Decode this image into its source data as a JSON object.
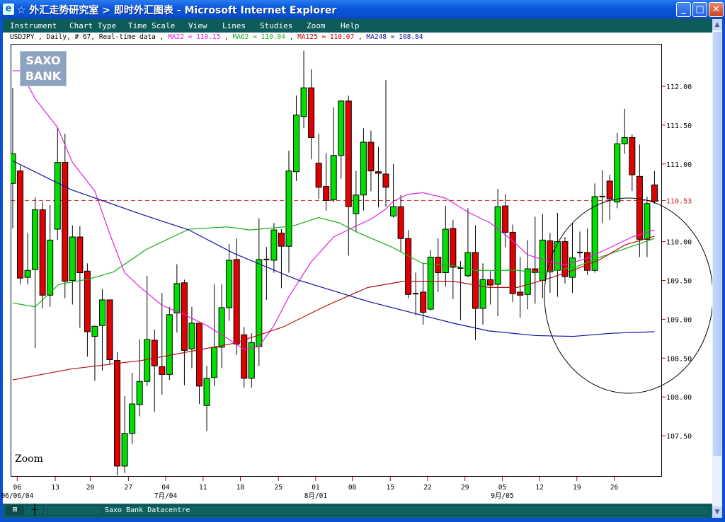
{
  "window": {
    "title": "☆ 外汇走势研究室 > 即时外汇图表 - Microsoft Internet Explorer",
    "app_icon": "ie-icon",
    "buttons": {
      "minimize": "_",
      "maximize": "□",
      "close": "✕"
    }
  },
  "menu": [
    "Instrument",
    "Chart Type",
    "Time Scale",
    "View",
    "Lines",
    "Studies",
    "Zoom",
    "Help"
  ],
  "info": {
    "instrument": "USDJPY , Daily, # 67, Real-time data",
    "sep": " , ",
    "ma22": "MA22 = 110.15",
    "ma62": "MA62 = 110.04",
    "ma125": "MA125 = 110.07",
    "ma248": "MA248 = 108.84"
  },
  "logo": {
    "line1": "SAXO",
    "line2": "BANK"
  },
  "zoom_label": "Zoom",
  "status": {
    "text": "Saxo Bank Datacentre"
  },
  "colors": {
    "up": "#00e000",
    "down": "#e00000",
    "ma22": "#e020e0",
    "ma62": "#18b018",
    "ma125": "#b01010",
    "ma248": "#1010a0",
    "menu_bg": "#0e5b5b"
  },
  "chart_data": {
    "type": "candlestick",
    "title": "USDJPY Daily",
    "ylim": [
      106.9,
      112.55
    ],
    "y_ticks": [
      "112.00",
      "111.50",
      "111.00",
      "110.00",
      "109.50",
      "109.00",
      "108.50",
      "108.00",
      "107.50"
    ],
    "current_price": "110.53",
    "x_ticks": [
      {
        "label": "06",
        "index": 0.6,
        "sub": "06/06/04"
      },
      {
        "label": "13",
        "index": 5.7
      },
      {
        "label": "20",
        "index": 10.4
      },
      {
        "label": "27",
        "index": 15.5
      },
      {
        "label": "04",
        "index": 20.5,
        "sub": "7月/04"
      },
      {
        "label": "11",
        "index": 25.5
      },
      {
        "label": "18",
        "index": 30.5
      },
      {
        "label": "25",
        "index": 35.6
      },
      {
        "label": "01",
        "index": 40.6,
        "sub": "8月/01"
      },
      {
        "label": "08",
        "index": 45.5
      },
      {
        "label": "15",
        "index": 50.6
      },
      {
        "label": "22",
        "index": 55.6
      },
      {
        "label": "29",
        "index": 60.6
      },
      {
        "label": "05",
        "index": 65.6,
        "sub": "9月/05"
      },
      {
        "label": "12",
        "index": 70.6
      },
      {
        "label": "19",
        "index": 75.6
      },
      {
        "label": "26",
        "index": 80.6
      }
    ],
    "ohlc": [
      [
        110.75,
        111.98,
        110.17,
        111.13
      ],
      [
        110.91,
        110.98,
        109.45,
        109.53
      ],
      [
        109.54,
        110.11,
        109.45,
        109.63
      ],
      [
        109.64,
        110.57,
        108.63,
        110.41
      ],
      [
        110.41,
        110.51,
        109.14,
        109.31
      ],
      [
        109.31,
        110.47,
        109.16,
        110.02
      ],
      [
        110.16,
        111.47,
        110.02,
        111.02
      ],
      [
        111.02,
        111.39,
        109.27,
        109.49
      ],
      [
        109.5,
        110.21,
        109.19,
        110.06
      ],
      [
        110.06,
        110.2,
        108.89,
        109.6
      ],
      [
        109.62,
        109.72,
        108.52,
        108.84
      ],
      [
        108.78,
        108.92,
        108.21,
        108.91
      ],
      [
        108.92,
        109.39,
        108.34,
        109.25
      ],
      [
        109.25,
        109.25,
        108.42,
        108.48
      ],
      [
        108.47,
        108.58,
        106.99,
        107.11
      ],
      [
        107.11,
        108.01,
        107.02,
        107.53
      ],
      [
        107.53,
        108.31,
        107.39,
        107.91
      ],
      [
        107.9,
        108.74,
        107.75,
        108.2
      ],
      [
        108.2,
        109.56,
        108.14,
        108.74
      ],
      [
        108.73,
        108.87,
        107.81,
        108.4
      ],
      [
        108.39,
        109.34,
        108.03,
        108.29
      ],
      [
        108.29,
        109.16,
        108.22,
        109.06
      ],
      [
        109.08,
        109.71,
        108.83,
        109.46
      ],
      [
        109.47,
        109.51,
        108.15,
        108.6
      ],
      [
        108.62,
        109.16,
        108.37,
        108.95
      ],
      [
        108.95,
        108.95,
        107.91,
        108.14
      ],
      [
        107.89,
        108.4,
        107.56,
        108.24
      ],
      [
        108.25,
        109.45,
        108.14,
        108.64
      ],
      [
        108.64,
        109.45,
        108.37,
        109.15
      ],
      [
        109.15,
        109.97,
        108.98,
        109.76
      ],
      [
        109.77,
        110.04,
        108.54,
        108.68
      ],
      [
        108.8,
        108.9,
        108.12,
        108.24
      ],
      [
        108.24,
        108.82,
        108.12,
        108.7
      ],
      [
        108.65,
        110.3,
        108.4,
        109.77
      ],
      [
        109.77,
        109.93,
        109.25,
        109.77
      ],
      [
        109.76,
        110.24,
        109.6,
        110.15
      ],
      [
        110.11,
        110.16,
        109.4,
        109.94
      ],
      [
        109.94,
        111.17,
        109.6,
        110.91
      ],
      [
        110.9,
        111.88,
        110.78,
        111.63
      ],
      [
        111.61,
        112.46,
        111.46,
        111.98
      ],
      [
        111.98,
        112.22,
        111.06,
        111.34
      ],
      [
        111.01,
        111.39,
        110.55,
        110.7
      ],
      [
        110.71,
        111.14,
        110.4,
        110.53
      ],
      [
        110.54,
        111.73,
        110.51,
        111.11
      ],
      [
        111.11,
        111.82,
        110.81,
        111.81
      ],
      [
        111.81,
        111.88,
        109.82,
        110.45
      ],
      [
        110.36,
        110.91,
        110.12,
        110.6
      ],
      [
        110.6,
        111.46,
        110.4,
        111.28
      ],
      [
        111.28,
        111.43,
        110.65,
        110.91
      ],
      [
        110.9,
        111.22,
        110.44,
        110.88
      ],
      [
        110.87,
        112.08,
        110.45,
        110.7
      ],
      [
        110.33,
        111.0,
        110.31,
        110.45
      ],
      [
        110.45,
        110.6,
        109.87,
        110.04
      ],
      [
        110.04,
        110.15,
        109.27,
        109.32
      ],
      [
        109.33,
        109.6,
        109.05,
        109.33
      ],
      [
        109.35,
        109.73,
        108.93,
        109.09
      ],
      [
        109.13,
        109.89,
        109.11,
        109.8
      ],
      [
        109.8,
        110.04,
        109.35,
        109.6
      ],
      [
        109.6,
        110.46,
        109.42,
        110.16
      ],
      [
        110.17,
        110.28,
        109.26,
        109.67
      ],
      [
        109.66,
        109.75,
        108.99,
        109.66
      ],
      [
        109.56,
        110.43,
        109.54,
        109.86
      ],
      [
        109.86,
        110.21,
        108.73,
        109.14
      ],
      [
        109.14,
        109.72,
        108.93,
        109.51
      ],
      [
        109.51,
        109.62,
        109.19,
        109.44
      ],
      [
        109.45,
        110.68,
        109.04,
        110.45
      ],
      [
        110.46,
        110.61,
        109.93,
        110.12
      ],
      [
        110.12,
        110.22,
        109.22,
        109.33
      ],
      [
        109.35,
        109.8,
        109.02,
        109.31
      ],
      [
        109.32,
        110.02,
        109.13,
        109.65
      ],
      [
        109.65,
        110.32,
        109.2,
        109.6
      ],
      [
        109.5,
        110.36,
        109.27,
        110.02
      ],
      [
        110.01,
        110.11,
        109.34,
        109.61
      ],
      [
        109.63,
        110.37,
        109.29,
        110.0
      ],
      [
        110.0,
        110.06,
        109.46,
        109.55
      ],
      [
        109.54,
        110.24,
        109.34,
        109.79
      ],
      [
        109.86,
        110.13,
        109.79,
        109.86
      ],
      [
        109.86,
        110.17,
        109.57,
        109.63
      ],
      [
        109.63,
        110.75,
        109.6,
        110.58
      ],
      [
        110.58,
        110.92,
        110.24,
        110.58
      ],
      [
        110.78,
        110.86,
        110.28,
        110.55
      ],
      [
        110.51,
        111.4,
        110.43,
        111.26
      ],
      [
        111.26,
        111.71,
        111.13,
        111.34
      ],
      [
        111.34,
        111.38,
        110.65,
        110.86
      ],
      [
        110.84,
        111.25,
        109.8,
        110.03
      ],
      [
        110.03,
        110.58,
        109.8,
        110.49
      ],
      [
        110.73,
        110.91,
        110.49,
        110.52
      ]
    ],
    "series": [
      {
        "name": "MA22",
        "color": "#e020e0",
        "points": [
          [
            0,
            112.2
          ],
          [
            1,
            112.2
          ],
          [
            3,
            111.84
          ],
          [
            6,
            111.47
          ],
          [
            8,
            111.02
          ],
          [
            11,
            110.65
          ],
          [
            13,
            110.1
          ],
          [
            15,
            109.6
          ],
          [
            17,
            109.42
          ],
          [
            20,
            109.18
          ],
          [
            23,
            109.06
          ],
          [
            26,
            108.92
          ],
          [
            29,
            108.74
          ],
          [
            31,
            108.61
          ],
          [
            33,
            108.65
          ],
          [
            35,
            108.92
          ],
          [
            37,
            109.29
          ],
          [
            40,
            109.74
          ],
          [
            43,
            110.06
          ],
          [
            46,
            110.2
          ],
          [
            48,
            110.29
          ],
          [
            50,
            110.42
          ],
          [
            51,
            110.52
          ],
          [
            53,
            110.61
          ],
          [
            55,
            110.63
          ],
          [
            58,
            110.56
          ],
          [
            61,
            110.38
          ],
          [
            64,
            110.24
          ],
          [
            67,
            110.01
          ],
          [
            69,
            109.83
          ],
          [
            72,
            109.74
          ],
          [
            74,
            109.7
          ],
          [
            77,
            109.79
          ],
          [
            80,
            109.92
          ],
          [
            83,
            110.06
          ],
          [
            86,
            110.15
          ]
        ]
      },
      {
        "name": "MA62",
        "color": "#18b018",
        "points": [
          [
            0,
            109.21
          ],
          [
            3,
            109.16
          ],
          [
            6.2,
            109.45
          ],
          [
            10.3,
            109.52
          ],
          [
            13.5,
            109.61
          ],
          [
            17.9,
            109.9
          ],
          [
            23.6,
            110.16
          ],
          [
            28.7,
            110.19
          ],
          [
            31.8,
            110.15
          ],
          [
            37.5,
            110.2
          ],
          [
            41,
            110.31
          ],
          [
            43.8,
            110.24
          ],
          [
            46.4,
            110.11
          ],
          [
            50.8,
            109.93
          ],
          [
            54.9,
            109.72
          ],
          [
            59,
            109.69
          ],
          [
            62.1,
            109.63
          ],
          [
            67.6,
            109.63
          ],
          [
            70.7,
            109.6
          ],
          [
            75.4,
            109.67
          ],
          [
            78.7,
            109.8
          ],
          [
            81.8,
            109.9
          ],
          [
            86,
            110.04
          ]
        ]
      },
      {
        "name": "MA125",
        "color": "#b01010",
        "points": [
          [
            0,
            108.22
          ],
          [
            7.8,
            108.36
          ],
          [
            17.3,
            108.47
          ],
          [
            29.6,
            108.69
          ],
          [
            36.2,
            108.9
          ],
          [
            41.9,
            109.17
          ],
          [
            47.6,
            109.41
          ],
          [
            52.4,
            109.49
          ],
          [
            59,
            109.49
          ],
          [
            63.8,
            109.41
          ],
          [
            67.6,
            109.41
          ],
          [
            71.3,
            109.51
          ],
          [
            75.1,
            109.63
          ],
          [
            78.7,
            109.77
          ],
          [
            82.1,
            109.96
          ],
          [
            86,
            110.07
          ]
        ]
      },
      {
        "name": "MA248",
        "color": "#1010a0",
        "points": [
          [
            0,
            111.04
          ],
          [
            7.8,
            110.67
          ],
          [
            17.3,
            110.35
          ],
          [
            23.6,
            110.15
          ],
          [
            29.6,
            109.85
          ],
          [
            38.1,
            109.51
          ],
          [
            47.6,
            109.23
          ],
          [
            59,
            108.95
          ],
          [
            63.8,
            108.85
          ],
          [
            70.1,
            108.79
          ],
          [
            75.1,
            108.78
          ],
          [
            80.2,
            108.82
          ],
          [
            86,
            108.84
          ]
        ]
      }
    ]
  }
}
